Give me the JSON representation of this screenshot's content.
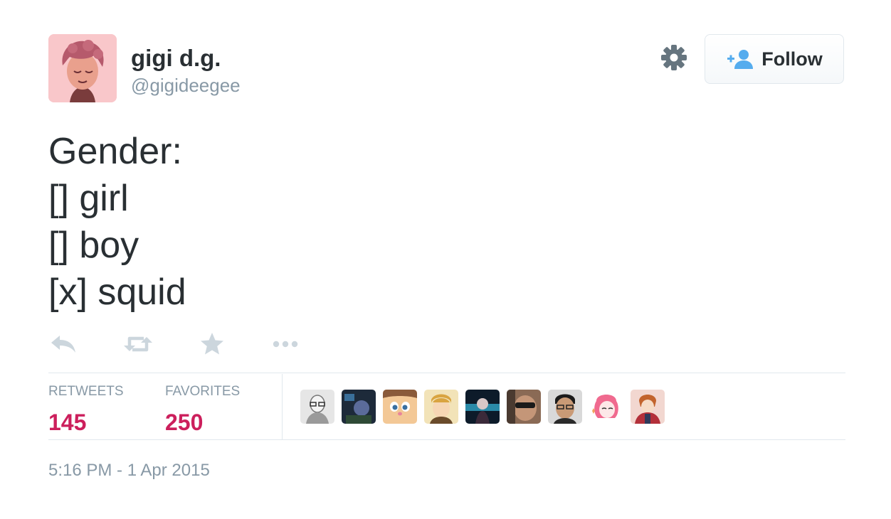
{
  "user": {
    "name": "gigi d.g.",
    "handle": "@gigideegee"
  },
  "follow_button": {
    "label": "Follow"
  },
  "tweet": {
    "lines": [
      "Gender:",
      "[] girl",
      "[] boy",
      "[x] squid"
    ]
  },
  "stats": {
    "retweets_label": "RETWEETS",
    "retweets_count": "145",
    "favorites_label": "FAVORITES",
    "favorites_count": "250"
  },
  "timestamp": "5:16 PM - 1 Apr 2015",
  "colors": {
    "stat_value": "#cc1f5c",
    "muted_text": "#8899a6",
    "follow_icon": "#55acee"
  },
  "icons": {
    "settings": "gear-icon",
    "follow": "add-user-icon",
    "reply": "reply-icon",
    "retweet": "retweet-icon",
    "favorite": "star-icon",
    "more": "more-dots-icon"
  }
}
